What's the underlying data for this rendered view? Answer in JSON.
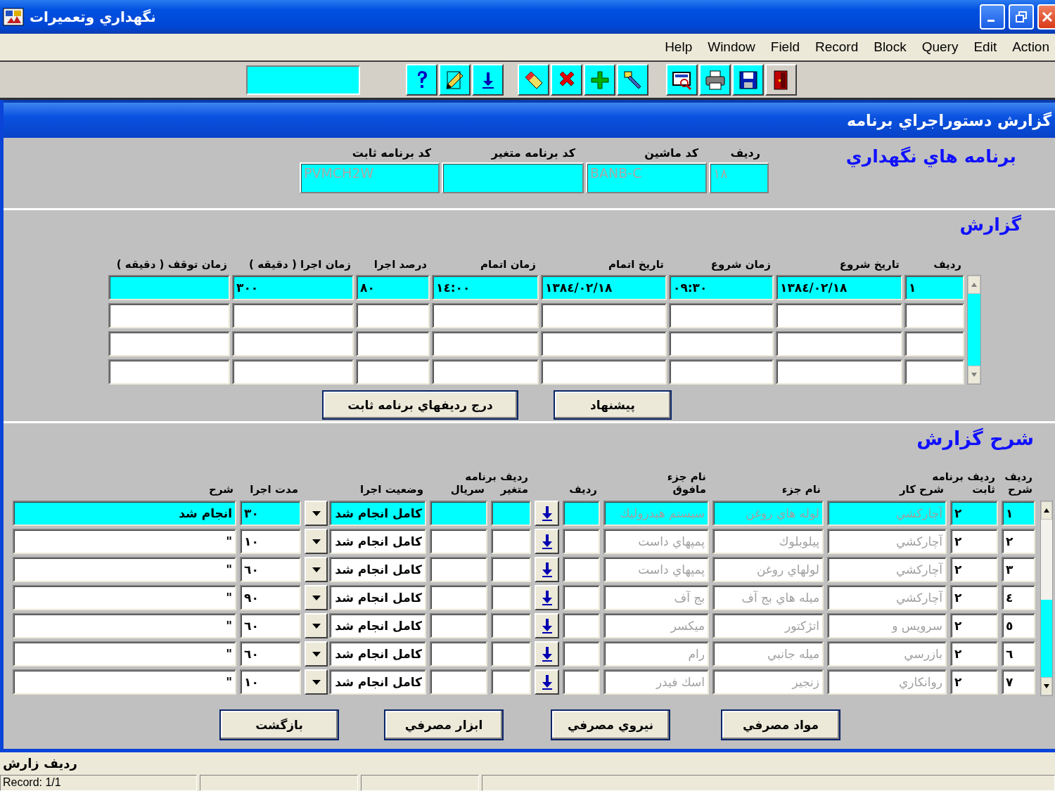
{
  "window": {
    "title": "نگهداري وتعميرات"
  },
  "menu": [
    "Action",
    "Edit",
    "Query",
    "Block",
    "Record",
    "Field",
    "Window",
    "Help"
  ],
  "form": {
    "title": "گزارش دستوراجراي برنامه"
  },
  "program": {
    "heading": "برنامه هاي نگهداري",
    "fields": [
      {
        "label": "رديف",
        "value": "١٨",
        "disabled": true
      },
      {
        "label": "كد ماشين",
        "value": "BANB-C",
        "disabled": true
      },
      {
        "label": "كد برنامه متغير"
      },
      {
        "label": "كد برنامه ثابت",
        "value": "PVMCH2W",
        "disabled": true
      }
    ]
  },
  "report": {
    "heading": "گزارش",
    "columns": [
      "رديف",
      "تاريخ  شروع",
      "زمان شروع",
      "تاريخ اتمام",
      "زمان اتمام",
      "درصد اجرا",
      "زمان اجرا ( دقيقه )",
      "زمان توقف ( دقيقه )"
    ],
    "rows": [
      {
        "selected": true,
        "row": "١",
        "start_date": "١٣٨٤/٠٢/١٨",
        "start_time": "٠٩:٣٠",
        "end_date": "١٣٨٤/٠٢/١٨",
        "end_time": "١٤:٠٠",
        "percent": "٨٠",
        "run_time": "٣٠٠"
      },
      {
        "selected": false
      },
      {
        "selected": false
      },
      {
        "selected": false
      }
    ],
    "buttons": [
      "پيشنهاد",
      "درج رديفهاي برنامه ثابت"
    ]
  },
  "details": {
    "heading": "شرح گزارش",
    "columns": [
      {
        "lines": [
          "رديف",
          "شرح"
        ],
        "kind": "number"
      },
      {
        "lines": [
          "رديف برنامه",
          "ثابت"
        ],
        "kind": "number"
      },
      {
        "lines": [
          "شرح كار"
        ],
        "kind": "text",
        "disabled": true
      },
      {
        "lines": [
          "نام جزء"
        ],
        "kind": "text",
        "disabled": true
      },
      {
        "lines": [
          "نام جزء",
          "مافوق"
        ],
        "kind": "text",
        "disabled": true
      },
      {
        "lines": [
          "رديف"
        ],
        "kind": "number"
      },
      {
        "kind": "lookup"
      },
      {
        "lines": [
          "رديف برنامه",
          "متغير"
        ],
        "kind": "number"
      },
      {
        "lines": [
          "سريال"
        ],
        "kind": "number"
      },
      {
        "lines": [
          "وضعيت اجرا"
        ],
        "kind": "combo"
      },
      {
        "lines": [
          "مدت اجرا"
        ],
        "kind": "number"
      },
      {
        "lines": [
          "شرح"
        ],
        "kind": "text"
      }
    ],
    "rows": [
      {
        "selected": true,
        "row": "١",
        "fixed_row": "٢",
        "task": "آچاركشي",
        "part": "لوله هاي روغن",
        "parent_part": "سيستم هيدروليك",
        "status": "كامل انجام شد",
        "duration": "٣٠",
        "note": "انجام شد"
      },
      {
        "selected": false,
        "row": "٢",
        "fixed_row": "٢",
        "task": "آچاركشي",
        "part": "پيلوبلوك",
        "parent_part": "پمپهاي داست",
        "status": "كامل انجام شد",
        "duration": "١٠",
        "note": "\""
      },
      {
        "selected": false,
        "row": "٣",
        "fixed_row": "٢",
        "task": "آچاركشي",
        "part": "لولهاي روغن",
        "parent_part": "پمپهاي داست",
        "status": "كامل انجام شد",
        "duration": "٦٠",
        "note": "\""
      },
      {
        "selected": false,
        "row": "٤",
        "fixed_row": "٢",
        "task": "آچاركشي",
        "part": "ميله هاي بج آف",
        "parent_part": "بج آف",
        "status": "كامل انجام شد",
        "duration": "٩٠",
        "note": "\""
      },
      {
        "selected": false,
        "row": "٥",
        "fixed_row": "٢",
        "task": "سرويس و",
        "part": "اتژكتور",
        "parent_part": "ميكسر",
        "status": "كامل انجام شد",
        "duration": "٦٠",
        "note": "\""
      },
      {
        "selected": false,
        "row": "٦",
        "fixed_row": "٢",
        "task": "بازرسي",
        "part": "ميله جانبي",
        "parent_part": "رام",
        "status": "كامل انجام شد",
        "duration": "٦٠",
        "note": "\""
      },
      {
        "selected": false,
        "row": "٧",
        "fixed_row": "٢",
        "task": "روانكاري",
        "part": "زنجير",
        "parent_part": "اسك فيدر",
        "status": "كامل انجام شد",
        "duration": "١٠",
        "note": "\""
      }
    ]
  },
  "actions": [
    "مواد مصرفي",
    "نيروي مصرفي",
    "ابزار مصرفي",
    "بازگشت"
  ],
  "status_bar": {
    "message": "رديف زارش",
    "record": "Record: 1/1"
  }
}
